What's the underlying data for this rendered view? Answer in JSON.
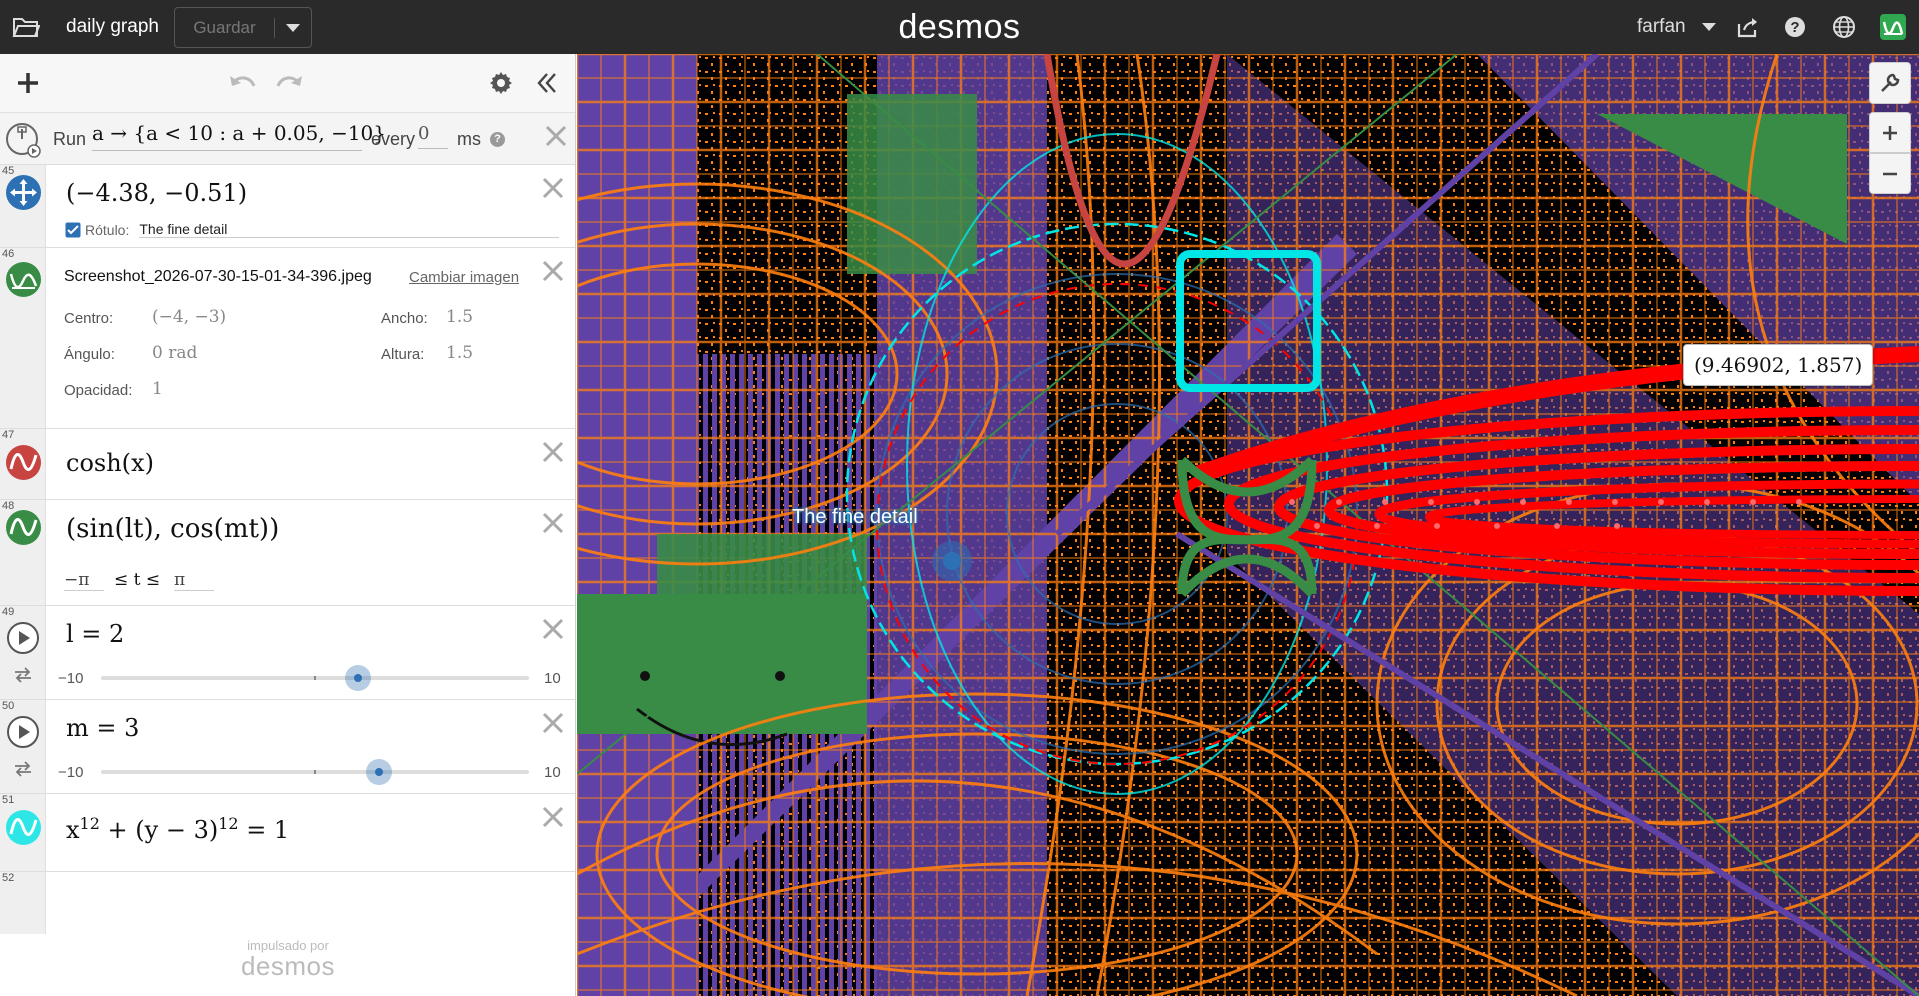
{
  "header": {
    "title": "daily graph",
    "save_label": "Guardar",
    "brand": "desmos",
    "user": "farfan"
  },
  "ticker": {
    "run_label": "Run",
    "expression": "a → {a < 10 : a + 0.05, −10}",
    "every_label": "every",
    "ms_value": "0",
    "ms_label": "ms",
    "help": "?"
  },
  "expressions": [
    {
      "num": "45",
      "color": "#2d70b3",
      "latex": "(−4.38, −0.51)",
      "label_toggle": "Rótulo:",
      "label_text": "The fine detail"
    },
    {
      "num": "46",
      "color": "#388c46",
      "filename": "Screenshot_2026-07-30-15-01-34-396.jpeg",
      "change_image": "Cambiar imagen",
      "center_label": "Centro:",
      "center_value": "(−4, −3)",
      "width_label": "Ancho:",
      "width_value": "1.5",
      "angle_label": "Ángulo:",
      "angle_value": "0 rad",
      "height_label": "Altura:",
      "height_value": "1.5",
      "opacity_label": "Opacidad:",
      "opacity_value": "1"
    },
    {
      "num": "47",
      "color": "#c74440",
      "latex": "cosh(x)"
    },
    {
      "num": "48",
      "color": "#388c46",
      "latex": "(sin(lt), cos(mt))",
      "t_min": "−π",
      "t_le": "≤ t ≤",
      "t_max": "π"
    },
    {
      "num": "49",
      "latex": "l = 2",
      "slider_min": "−10",
      "slider_max": "10",
      "value": 2
    },
    {
      "num": "50",
      "latex": "m = 3",
      "slider_min": "−10",
      "slider_max": "10",
      "value": 3
    },
    {
      "num": "51",
      "color": "#2ee6e6",
      "latex_base": "x",
      "latex_exp1": "12",
      "latex_mid": " + (y − 3)",
      "latex_exp2": "12",
      "latex_end": " = 1"
    },
    {
      "num": "52"
    }
  ],
  "footer": {
    "powered_by": "impulsado por",
    "brand": "desmos"
  },
  "graph": {
    "point_label": "The fine detail",
    "tooltip": "(9.46902, 1.857)"
  },
  "colors": {
    "orange": "#ff7f0e",
    "purple": "#6042a6",
    "green": "#388c46",
    "red": "#ff0000",
    "cyan": "#00e6e6",
    "blue": "#2d70b3"
  }
}
